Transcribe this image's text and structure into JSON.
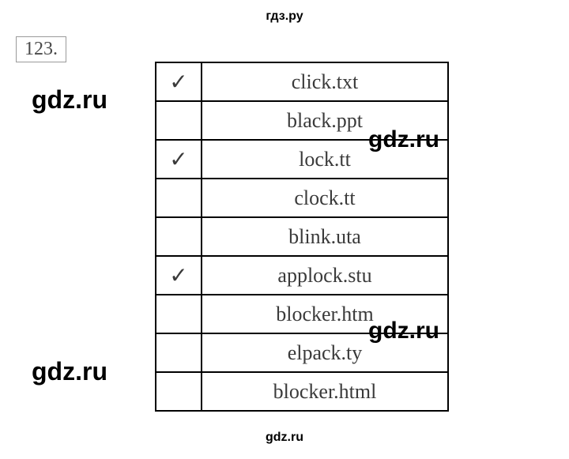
{
  "header": {
    "site": "гдз.ру"
  },
  "task": {
    "number": "123."
  },
  "table": {
    "rows": [
      {
        "checked": true,
        "filename": "click.txt"
      },
      {
        "checked": false,
        "filename": "black.ppt"
      },
      {
        "checked": true,
        "filename": "lock.tt"
      },
      {
        "checked": false,
        "filename": "clock.tt"
      },
      {
        "checked": false,
        "filename": "blink.uta"
      },
      {
        "checked": true,
        "filename": "applock.stu"
      },
      {
        "checked": false,
        "filename": "blocker.htm"
      },
      {
        "checked": false,
        "filename": "elpack.ty"
      },
      {
        "checked": false,
        "filename": "blocker.html"
      }
    ]
  },
  "watermarks": {
    "w1": "gdz.ru",
    "w2": "gdz.ru",
    "w3": "gdz.ru",
    "w4": "gdz.ru",
    "footer": "gdz.ru"
  },
  "checkmark_glyph": "✓"
}
